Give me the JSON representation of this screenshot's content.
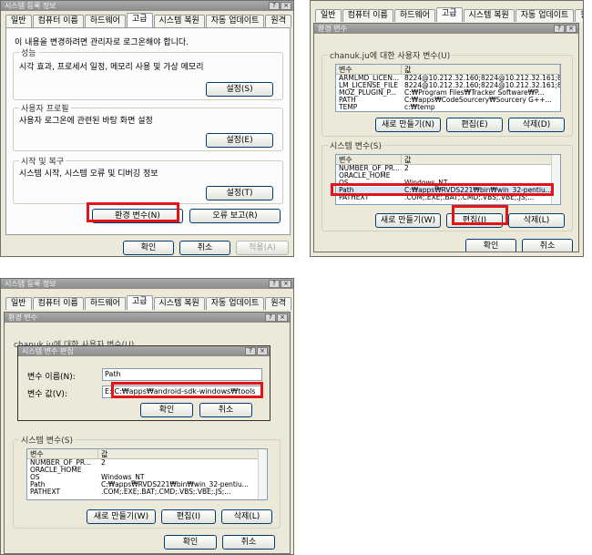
{
  "tabs": [
    "일반",
    "컴퓨터 이름",
    "하드웨어",
    "고급",
    "시스템 복원",
    "자동 업데이트",
    "원격"
  ],
  "win1": {
    "title": "시스템 등록 정보",
    "intro": "이 내용을 변경하려면 관리자로 로그온해야 합니다.",
    "perf_label": "성능",
    "perf_desc": "시각 효과, 프로세서 일정, 메모리 사용 및 가상 메모리",
    "perf_btn": "설정(S)",
    "profile_label": "사용자 프로필",
    "profile_desc": "사용자 로그온에 관련된 바탕 화면 설정",
    "profile_btn": "설정(E)",
    "startup_label": "시작 및 복구",
    "startup_desc": "시스템 시작, 시스템 오류 및 디버깅 정보",
    "startup_btn": "설정(T)",
    "env_btn": "환경 변수(N)",
    "error_btn": "오류 보고(R)",
    "ok": "확인",
    "cancel": "취소",
    "apply": "적용(A)"
  },
  "win2": {
    "title": "환경 변수",
    "user_group": "chanuk.ju에 대한 사용자 변수(U)",
    "col_var": "변수",
    "col_val": "값",
    "user_vars": [
      {
        "name": "ARMLMD_LICEN...",
        "value": "8224@10.212.32.160;8224@10.212.32.161;8..."
      },
      {
        "name": "LM_LICENSE_FILE",
        "value": "8224@10.212.32.160;8224@10.212.32.161;8..."
      },
      {
        "name": "MOZ_PLUGIN_P...",
        "value": "C:₩Program Files₩Tracker Software₩P..."
      },
      {
        "name": "PATH",
        "value": "C:₩apps₩CodeSourcery₩Sourcery G++..."
      },
      {
        "name": "TEMP",
        "value": "c:₩temp"
      }
    ],
    "new_btn": "새로 만들기(N)",
    "edit_btn": "편집(E)",
    "del_btn": "삭제(D)",
    "sys_group": "시스템 변수(S)",
    "sys_vars": [
      {
        "name": "NUMBER_OF_PR...",
        "value": "2"
      },
      {
        "name": "ORACLE_HOME",
        "value": ""
      },
      {
        "name": "OS",
        "value": "Windows_NT"
      },
      {
        "name": "Path",
        "value": "C:₩apps₩RVDS221₩bin₩win_32-pentiu..."
      },
      {
        "name": "PATHEXT",
        "value": ".COM;.EXE;.BAT;.CMD;.VBS;.VBE;.JS;..."
      }
    ],
    "sys_new_btn": "새로 만들기(W)",
    "sys_edit_btn": "편집(I)",
    "sys_del_btn": "삭제(L)",
    "ok": "확인",
    "cancel": "취소"
  },
  "win3": {
    "title": "시스템 등록 정보",
    "env_title": "환경 변수",
    "user_group": "chanuk.ju에 대한 사용자 변수(U)",
    "dialog_title": "시스템 변수 편집",
    "name_label": "변수 이름(N):",
    "name_value": "Path",
    "value_label": "변수 값(V):",
    "value_prefix": "E:",
    "value_highlight": ";C:₩apps₩android-sdk-windows₩tools",
    "ok": "확인",
    "cancel": "취소",
    "sys_group": "시스템 변수(S)",
    "col_var": "변수",
    "col_val": "값",
    "sys_vars": [
      {
        "name": "NUMBER_OF_PR...",
        "value": "2"
      },
      {
        "name": "ORACLE_HOME",
        "value": ""
      },
      {
        "name": "OS",
        "value": "Windows_NT"
      },
      {
        "name": "Path",
        "value": "C:₩apps₩RVDS221₩bin₩win_32-pentiu..."
      },
      {
        "name": "PATHEXT",
        "value": ".COM;.EXE;.BAT;.CMD;.VBS;.VBE;.JS;..."
      }
    ],
    "new_btn": "새로 만들기(W)",
    "edit_btn": "편집(I)",
    "del_btn": "삭제(L)",
    "ok2": "확인",
    "cancel2": "취소"
  },
  "colors": {
    "highlight": "#e2141a",
    "window_bg": "#ece9d8",
    "titlebar": "#9a9a9a"
  }
}
